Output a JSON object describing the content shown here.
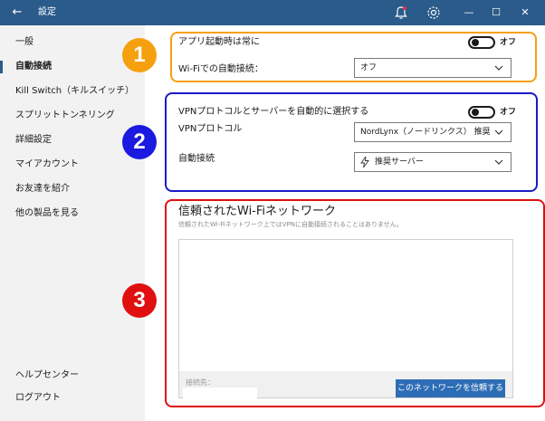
{
  "titlebar": {
    "back_glyph": "←",
    "title": "設定",
    "bell_icon": "bell-icon",
    "gear_icon": "gear-icon",
    "minimize": "—",
    "maximize": "☐",
    "close": "✕",
    "color": "#2b5b8a"
  },
  "sidebar": {
    "items": [
      {
        "label": "一般"
      },
      {
        "label": "自動接続",
        "active": true
      },
      {
        "label": "Kill Switch（キルスイッチ）"
      },
      {
        "label": "スプリットトンネリング"
      },
      {
        "label": "詳細設定"
      },
      {
        "label": "マイアカウント"
      },
      {
        "label": "お友達を紹介"
      },
      {
        "label": "他の製品を見る"
      }
    ],
    "bottom": [
      {
        "label": "ヘルプセンター"
      },
      {
        "label": "ログアウト"
      }
    ]
  },
  "section1": {
    "badge": "1",
    "badge_color": "#f5a00f",
    "frame_color": "#f5a00f",
    "always_label": "アプリ起動時は常に",
    "always_toggle": "オフ",
    "wifi_label": "Wi-Fiでの自動接続：",
    "wifi_select": "オフ"
  },
  "section2": {
    "badge": "2",
    "badge_color": "#1a1ae0",
    "frame_color": "#1a1ac8",
    "auto_select_label": "VPNプロトコルとサーバーを自動的に選択する",
    "auto_select_toggle": "オフ",
    "protocol_label": "VPNプロトコル",
    "protocol_select": "NordLynx（ノードリンクス） 推奨",
    "autoconnect_label": "自動接続",
    "autoconnect_select": "推奨サーバー"
  },
  "section3": {
    "badge": "3",
    "badge_color": "#e01010",
    "frame_color": "#e01010",
    "title": "信頼されたWi-Fiネットワーク",
    "description": "信頼されたWi-Fiネットワーク上ではVPNに自動接続されることはありません。",
    "connected_label": "接続先：",
    "trust_button": "このネットワークを信頼する",
    "button_color": "#2d6db5"
  }
}
